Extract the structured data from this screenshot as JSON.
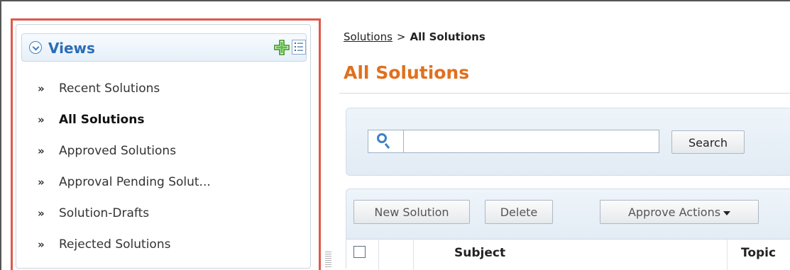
{
  "views_panel": {
    "title": "Views",
    "items": [
      {
        "label": "Recent Solutions",
        "active": false
      },
      {
        "label": "All Solutions",
        "active": true
      },
      {
        "label": "Approved Solutions",
        "active": false
      },
      {
        "label": "Approval Pending Solut...",
        "active": false
      },
      {
        "label": "Solution-Drafts",
        "active": false
      },
      {
        "label": "Rejected Solutions",
        "active": false
      }
    ],
    "item_chevron": "»",
    "icons": {
      "collapse": "chevron-down-circle-icon",
      "add": "plus-icon",
      "list": "list-view-icon"
    }
  },
  "breadcrumb": {
    "parent": "Solutions",
    "separator": ">",
    "current": "All Solutions"
  },
  "page_title": "All Solutions",
  "search": {
    "value": "",
    "button_label": "Search",
    "icon": "search-icon"
  },
  "toolbar": {
    "new_solution_label": "New Solution",
    "delete_label": "Delete",
    "approve_actions_label": "Approve Actions"
  },
  "table": {
    "columns": [
      "",
      "",
      "Subject",
      "Topic"
    ]
  },
  "colors": {
    "highlight_border": "#e0574a",
    "views_title": "#2c6cb5",
    "page_title": "#e0701e",
    "accent_green": "#3fae2a"
  }
}
